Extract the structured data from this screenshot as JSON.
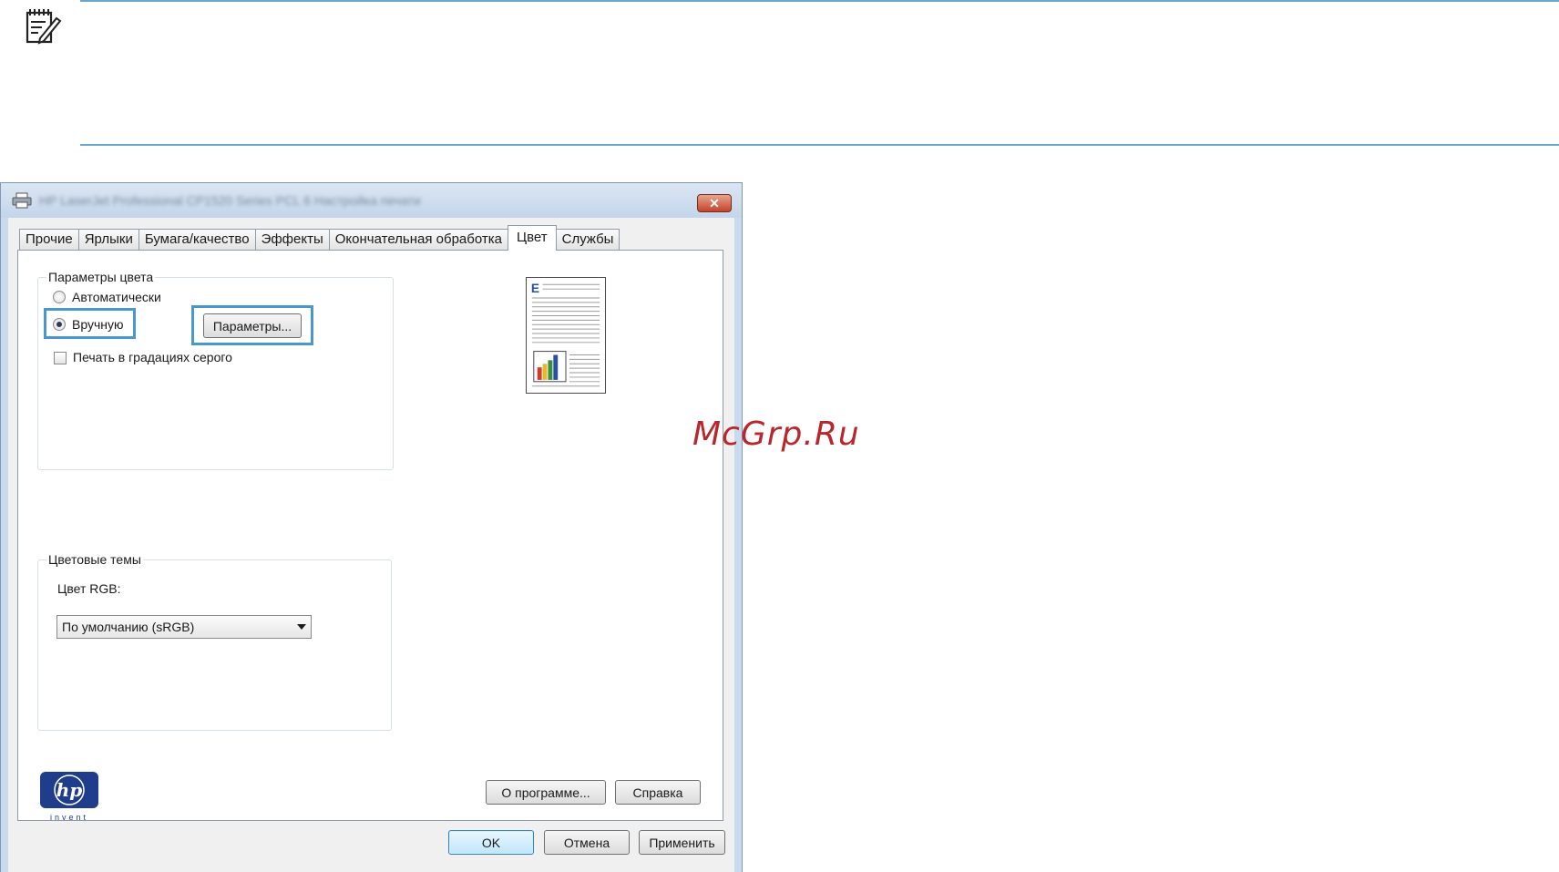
{
  "note_icon": "notepad-pencil-icon",
  "dialog": {
    "title": "HP LaserJet Professional CP1520 Series PCL 6 Настройка печати",
    "close_icon": "close-icon",
    "tabs": [
      {
        "label": "Прочие",
        "active": false
      },
      {
        "label": "Ярлыки",
        "active": false
      },
      {
        "label": "Бумага/качество",
        "active": false
      },
      {
        "label": "Эффекты",
        "active": false
      },
      {
        "label": "Окончательная обработка",
        "active": false
      },
      {
        "label": "Цвет",
        "active": true
      },
      {
        "label": "Службы",
        "active": false
      }
    ],
    "color_options": {
      "title": "Параметры цвета",
      "auto_label": "Автоматически",
      "manual_label": "Вручную",
      "manual_checked": true,
      "params_button": "Параметры...",
      "grayscale_label": "Печать в градациях серого",
      "grayscale_checked": false
    },
    "color_themes": {
      "title": "Цветовые темы",
      "rgb_label": "Цвет RGB:",
      "rgb_value": "По умолчанию (sRGB)"
    },
    "preview_letter": "E",
    "logo_text": "invent",
    "about_button": "О программе...",
    "help_button": "Справка",
    "ok_button": "OK",
    "cancel_button": "Отмена",
    "apply_button": "Применить"
  },
  "watermark": "McGrp.Ru",
  "colors": {
    "accent_rule": "#6aa7cf",
    "highlight": "#4a97cb",
    "watermark": "#b8272e",
    "hp_blue": "#1f3d8a"
  }
}
